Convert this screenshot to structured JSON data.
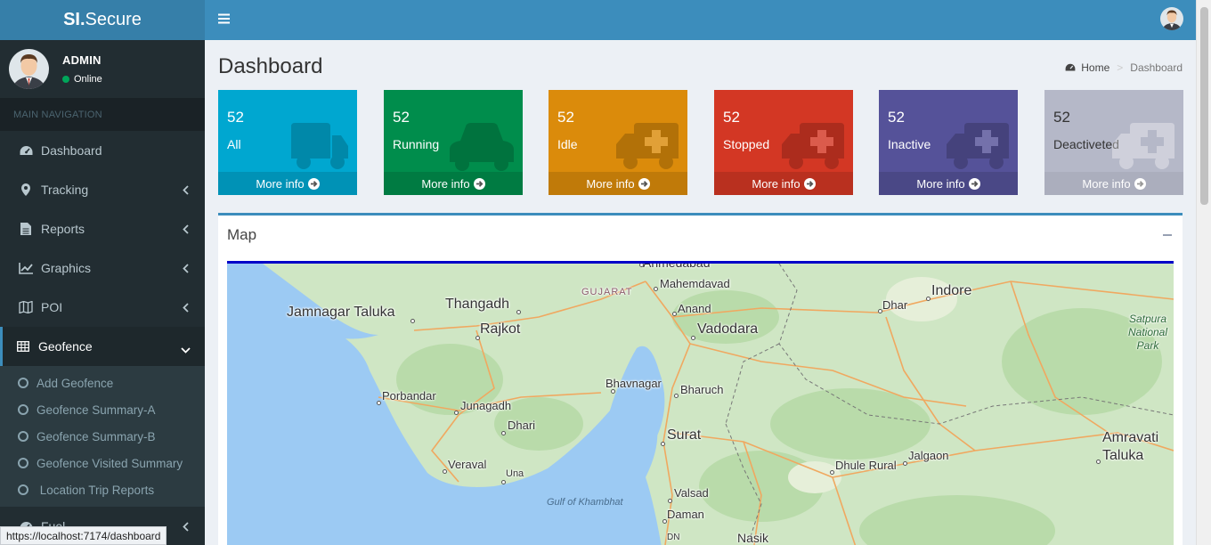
{
  "brand": {
    "bold": "SI.",
    "light": "Secure"
  },
  "user": {
    "name": "ADMIN",
    "status": "Online"
  },
  "nav": {
    "header": "MAIN NAVIGATION",
    "items": [
      {
        "label": "Dashboard",
        "icon": "dashboard-icon"
      },
      {
        "label": "Tracking",
        "icon": "map-marker-icon"
      },
      {
        "label": "Reports",
        "icon": "file-icon"
      },
      {
        "label": "Graphics",
        "icon": "line-chart-icon"
      },
      {
        "label": "POI",
        "icon": "map-icon"
      },
      {
        "label": "Geofence",
        "icon": "table-icon"
      }
    ],
    "geofence_sub": [
      "Add Geofence",
      "Geofence Summary-A",
      "Geofence Summary-B",
      "Geofence Visited Summary",
      " Location Trip Reports"
    ],
    "fuel": "Fuel"
  },
  "page": {
    "title": "Dashboard"
  },
  "breadcrumb": {
    "home": "Home",
    "sep": ">",
    "current": "Dashboard"
  },
  "stats": [
    {
      "count": "52",
      "label": "All",
      "color": "#00a7d0",
      "foot": "More info",
      "icon": "truck-icon"
    },
    {
      "count": "52",
      "label": "Running",
      "color": "#008d4c",
      "foot": "More info",
      "icon": "car-icon"
    },
    {
      "count": "52",
      "label": "Idle",
      "color": "#db8b0b",
      "foot": "More info",
      "icon": "ambulance-icon"
    },
    {
      "count": "52",
      "label": "Stopped",
      "color": "#d33724",
      "foot": "More info",
      "icon": "ambulance-icon"
    },
    {
      "count": "52",
      "label": "Inactive",
      "color": "#555299",
      "foot": "More info",
      "icon": "ambulance-icon"
    },
    {
      "count": "52",
      "label": "Deactiveted",
      "color": "#b5b8c8",
      "foot": "More info",
      "icon": "ambulance-icon"
    }
  ],
  "map": {
    "title": "Map",
    "labels": {
      "ahmedabad": "Ahmedabad",
      "mahemdavad": "Mahemdavad",
      "gujarat": "GUJARAT",
      "indore": "Indore",
      "jamnagar": "Jamnagar Taluka",
      "thangadh": "Thangadh",
      "rajkot": "Rajkot",
      "anand": "Anand",
      "vadodara": "Vadodara",
      "dhar": "Dhar",
      "satpura": "Satpura National Park",
      "porbandar": "Porbandar",
      "bhavnagar": "Bhavnagar",
      "bharuch": "Bharuch",
      "junagadh": "Junagadh",
      "dhari": "Dhari",
      "surat": "Surat",
      "dhule": "Dhule Rural",
      "jalgaon": "Jalgaon",
      "amravati1": "Amravati",
      "amravati2": "Taluka",
      "veraval": "Veraval",
      "una": "Una",
      "khambhat": "Gulf of Khambhat",
      "valsad": "Valsad",
      "daman": "Daman",
      "nasik": "Nasik",
      "dn": "DN"
    }
  },
  "status_url": "https://localhost:7174/dashboard"
}
